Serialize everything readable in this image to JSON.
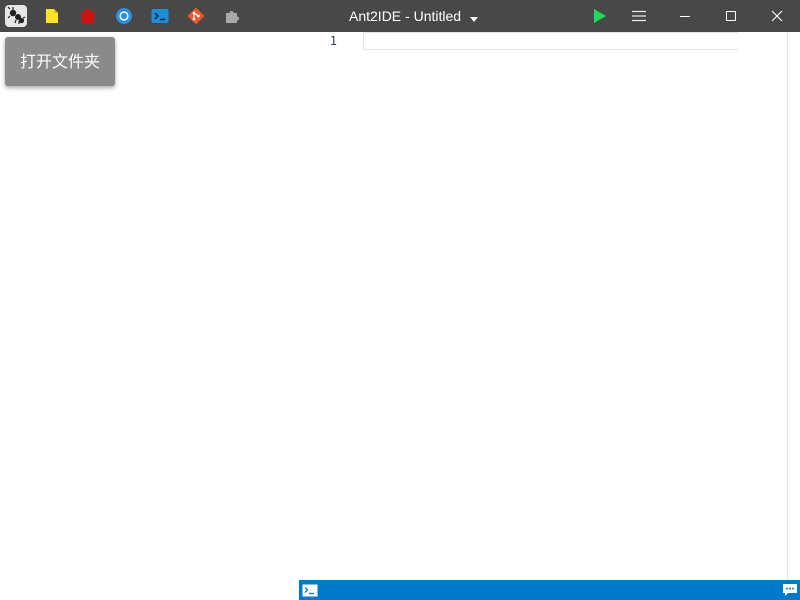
{
  "titlebar": {
    "title": "Ant2IDE - Untitled",
    "title_menu_icon": "caret-down-icon",
    "toolbar_icons": [
      "app-logo-icon",
      "new-file-icon",
      "home-icon",
      "browser-icon",
      "terminal-icon",
      "git-icon",
      "extensions-icon"
    ],
    "run_icon": "play-icon",
    "menu_icon": "hamburger-menu-icon",
    "window_controls": [
      "minimize-icon",
      "maximize-icon",
      "close-icon"
    ]
  },
  "sidebar": {
    "open_folder_label": "打开文件夹"
  },
  "editor": {
    "line_numbers": [
      "1"
    ],
    "lines": [
      ""
    ]
  },
  "statusbar": {
    "left_icon": "terminal-icon",
    "right_icon": "chat-icon"
  },
  "colors": {
    "titlebar_bg": "#484848",
    "statusbar_bg": "#007acc",
    "run_icon": "#1dd85a",
    "open_folder_bg": "#8a8a8a"
  }
}
